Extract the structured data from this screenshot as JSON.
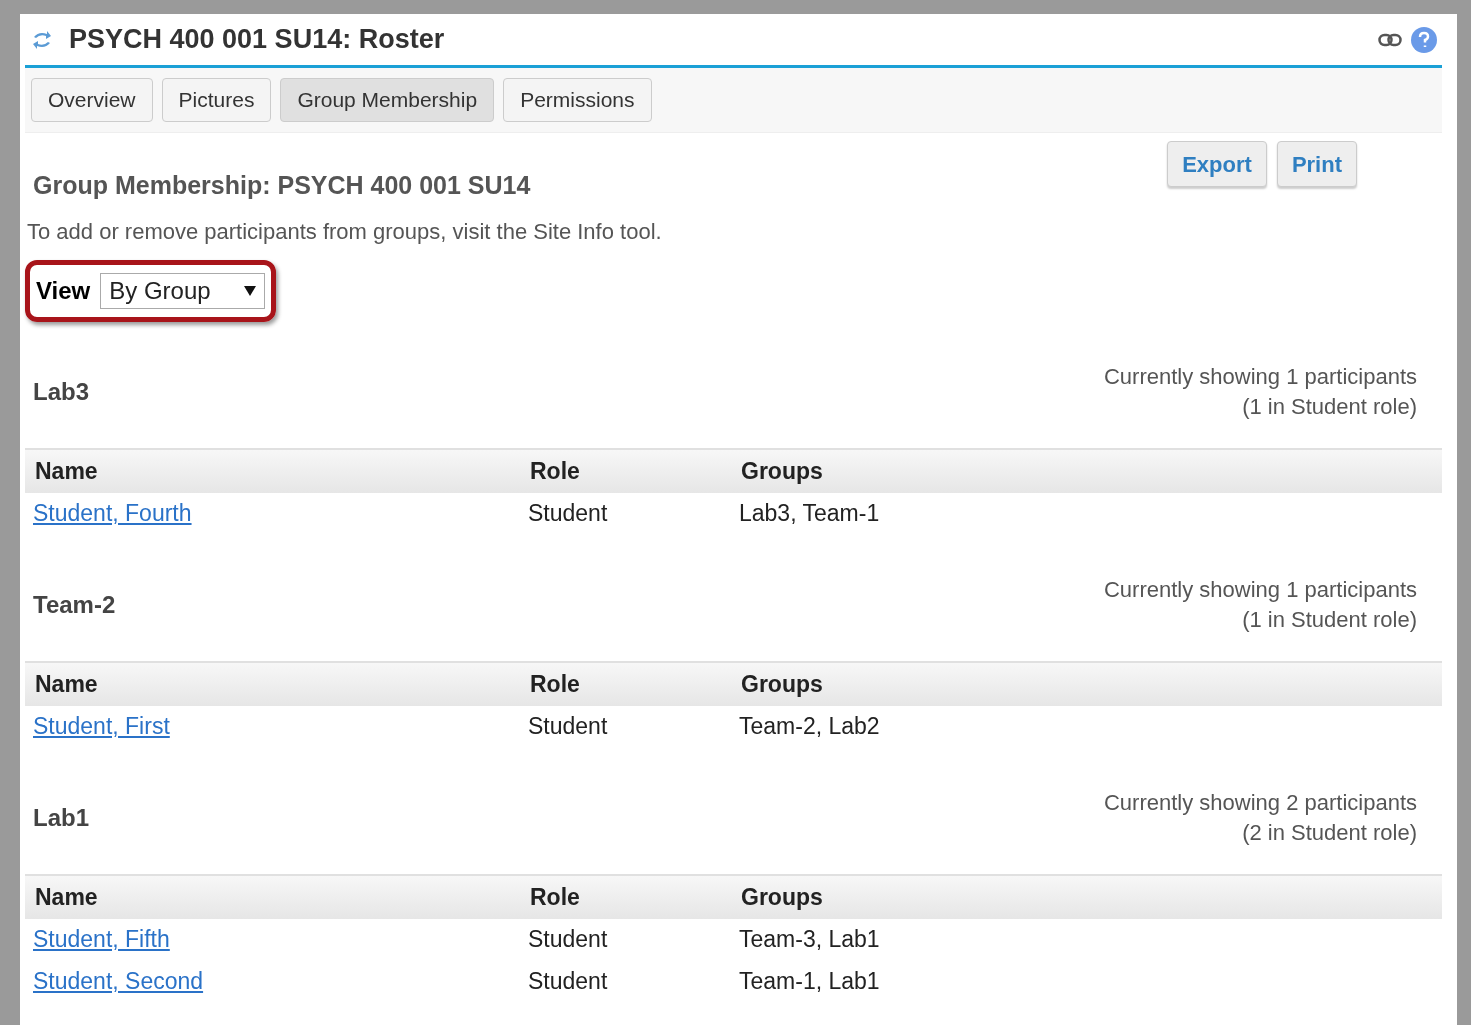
{
  "window": {
    "title": "PSYCH 400 001 SU14: Roster"
  },
  "tabs": [
    {
      "label": "Overview",
      "selected": false
    },
    {
      "label": "Pictures",
      "selected": false
    },
    {
      "label": "Group Membership",
      "selected": true
    },
    {
      "label": "Permissions",
      "selected": false
    }
  ],
  "actions": [
    "Export",
    "Print"
  ],
  "heading": "Group Membership: PSYCH 400 001 SU14",
  "instructions": "To add or remove participants from groups, visit the Site Info tool.",
  "view": {
    "label": "View",
    "value": "By Group",
    "highlighted": true
  },
  "groups": [
    {
      "name": "Lab3",
      "summary": [
        "Currently showing 1 participants",
        "(1 in Student role)"
      ],
      "columns": [
        "Name",
        "Role",
        "Groups"
      ],
      "rows": [
        {
          "name": "Student, Fourth",
          "role": "Student",
          "groups": "Lab3, Team-1"
        }
      ]
    },
    {
      "name": "Team-2",
      "summary": [
        "Currently showing 1 participants",
        "(1 in Student role)"
      ],
      "columns": [
        "Name",
        "Role",
        "Groups"
      ],
      "rows": [
        {
          "name": "Student, First",
          "role": "Student",
          "groups": "Team-2, Lab2"
        }
      ]
    },
    {
      "name": "Lab1",
      "summary": [
        "Currently showing 2 participants",
        "(2 in Student role)"
      ],
      "columns": [
        "Name",
        "Role",
        "Groups"
      ],
      "rows": [
        {
          "name": "Student, Fifth",
          "role": "Student",
          "groups": "Team-3, Lab1"
        },
        {
          "name": "Student, Second",
          "role": "Student",
          "groups": "Team-1, Lab1"
        }
      ]
    }
  ]
}
